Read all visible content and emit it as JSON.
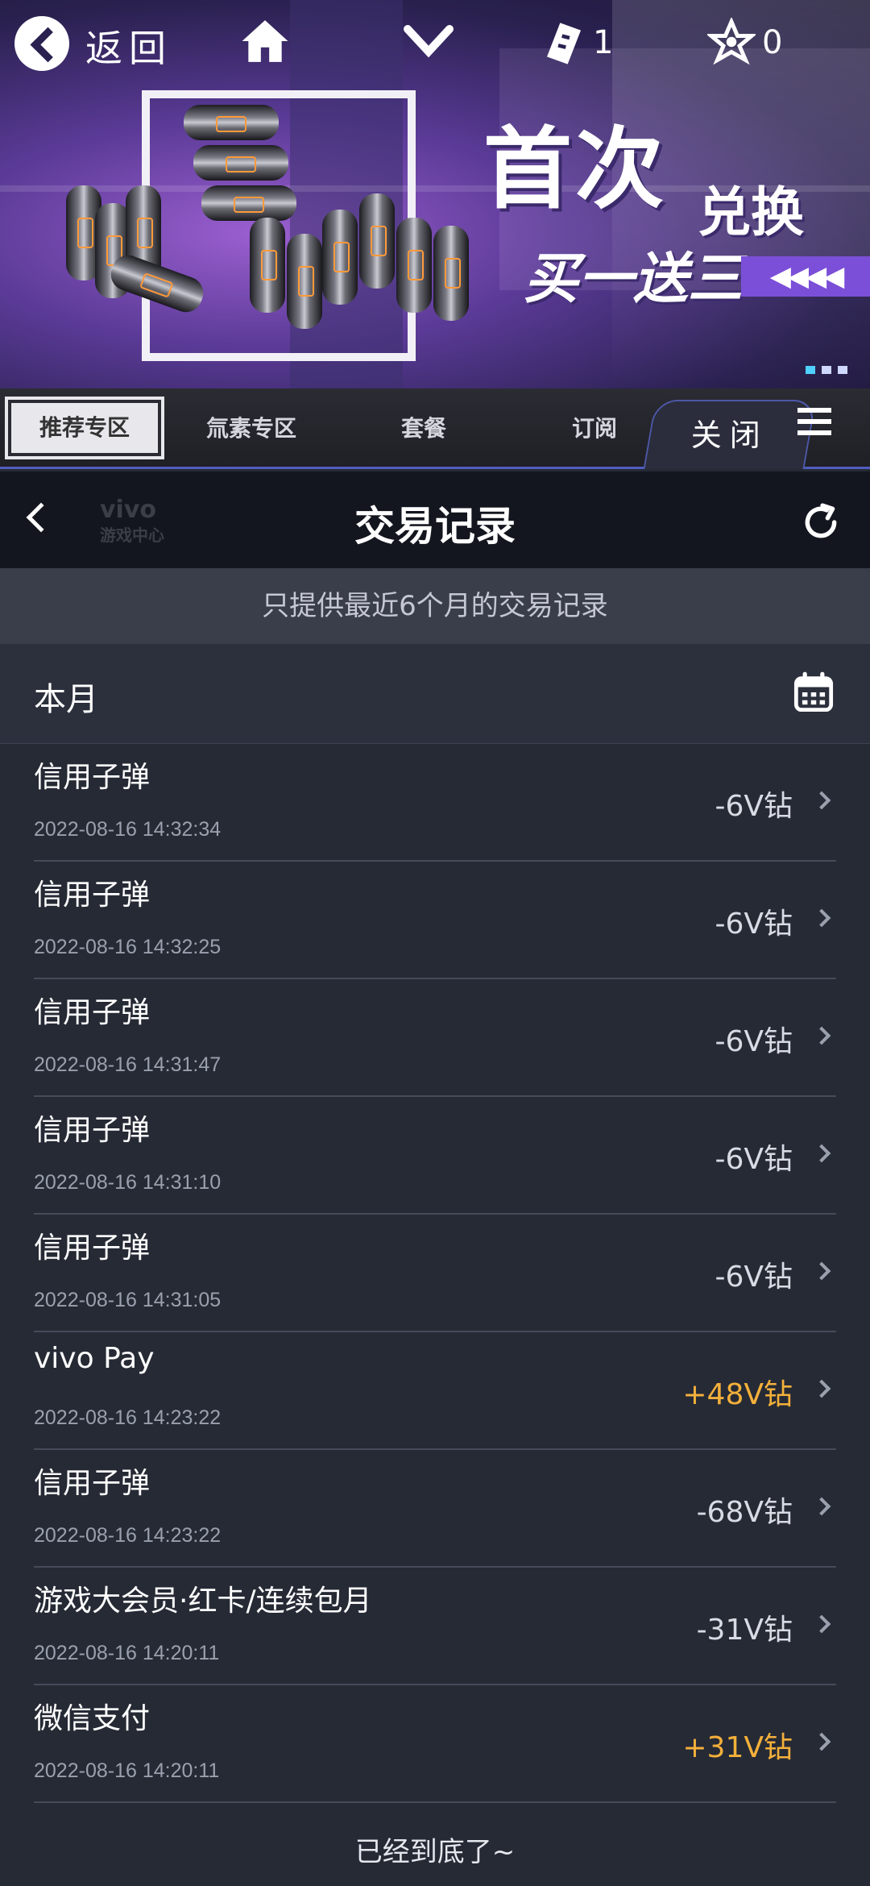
{
  "game_bar": {
    "back_label": "返回",
    "ticket_count": "1",
    "gem_count": "0"
  },
  "banner": {
    "headline": "首次",
    "line2": "兑换",
    "line3": "买一送三",
    "arrows": "◀◀◀◀"
  },
  "game_tabs": {
    "items": [
      {
        "label": "推荐专区"
      },
      {
        "label": "氚素专区"
      },
      {
        "label": "套餐"
      },
      {
        "label": "订阅"
      }
    ],
    "close_label": "关闭"
  },
  "header": {
    "title": "交易记录",
    "watermark": "vivo",
    "watermark_sub": "游戏中心"
  },
  "notice": "只提供最近6个月的交易记录",
  "month_label": "本月",
  "transactions": [
    {
      "title": "信用子弹",
      "time": "2022-08-16 14:32:34",
      "amount": "-6V钻",
      "positive": false
    },
    {
      "title": "信用子弹",
      "time": "2022-08-16 14:32:25",
      "amount": "-6V钻",
      "positive": false
    },
    {
      "title": "信用子弹",
      "time": "2022-08-16 14:31:47",
      "amount": "-6V钻",
      "positive": false
    },
    {
      "title": "信用子弹",
      "time": "2022-08-16 14:31:10",
      "amount": "-6V钻",
      "positive": false
    },
    {
      "title": "信用子弹",
      "time": "2022-08-16 14:31:05",
      "amount": "-6V钻",
      "positive": false
    },
    {
      "title": "vivo Pay",
      "time": "2022-08-16 14:23:22",
      "amount": "+48V钻",
      "positive": true
    },
    {
      "title": "信用子弹",
      "time": "2022-08-16 14:23:22",
      "amount": "-68V钻",
      "positive": false
    },
    {
      "title": "游戏大会员·红卡/连续包月",
      "time": "2022-08-16 14:20:11",
      "amount": "-31V钻",
      "positive": false
    },
    {
      "title": "微信支付",
      "time": "2022-08-16 14:20:11",
      "amount": "+31V钻",
      "positive": true
    }
  ],
  "footer": "已经到底了~",
  "colors": {
    "positive_amount": "#f4b03a",
    "background": "#262a35",
    "header": "#14161f"
  }
}
